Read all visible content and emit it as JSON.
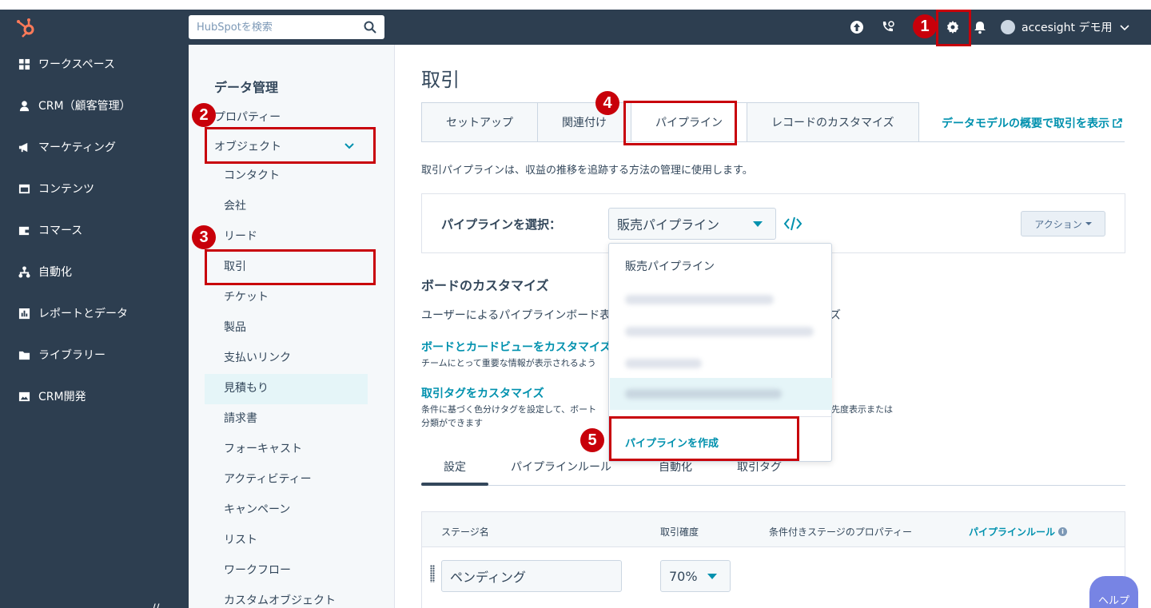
{
  "header": {
    "search_placeholder": "HubSpotを検索",
    "account_name": "accesight デモ用"
  },
  "leftnav": {
    "items": [
      {
        "label": "ワークスペース",
        "icon": "grid-icon"
      },
      {
        "label": "CRM（顧客管理）",
        "icon": "person-icon"
      },
      {
        "label": "マーケティング",
        "icon": "megaphone-icon"
      },
      {
        "label": "コンテンツ",
        "icon": "window-icon"
      },
      {
        "label": "コマース",
        "icon": "wallet-icon"
      },
      {
        "label": "自動化",
        "icon": "flow-icon"
      },
      {
        "label": "レポートとデータ",
        "icon": "report-icon"
      },
      {
        "label": "ライブラリー",
        "icon": "folder-icon"
      },
      {
        "label": "CRM開発",
        "icon": "image-icon"
      }
    ]
  },
  "subnav": {
    "title": "データ管理",
    "property": "プロパティー",
    "objects": "オブジェクト",
    "items": [
      "コンタクト",
      "会社",
      "リード",
      "取引",
      "チケット",
      "製品",
      "支払いリンク",
      "見積もり",
      "請求書",
      "フォーキャスト",
      "アクティビティー",
      "キャンペーン",
      "リスト",
      "ワークフロー",
      "カスタムオブジェクト"
    ]
  },
  "main": {
    "title": "取引",
    "tabs": [
      "セットアップ",
      "関連付け",
      "パイプライン",
      "レコードのカスタマイズ"
    ],
    "model_link": "データモデルの概要で取引を表示",
    "description": "取引パイプラインは、収益の推移を追跡する方法の管理に使用します。",
    "pipeline_label": "パイプラインを選択：",
    "pipeline_selected": "販売パイプライン",
    "action_label": "アクション",
    "board_title": "ボードのカスタマイズ",
    "board_desc": "ユーザーによるパイプラインボード表",
    "board_desc_tail": "ズ",
    "link_board": "ボードとカードビューをカスタマイズ",
    "link_board_desc": "チームにとって重要な情報が表示されるよう",
    "link_tags": "取引タグをカスタマイズ",
    "link_tags_desc": "条件に基づく色分けタグを設定して、ボート",
    "link_tags_desc2": "分類ができます",
    "link_tags_desc_tail": "先度表示または",
    "subtabs": [
      "設定",
      "パイプラインルール",
      "自動化",
      "取引タグ"
    ],
    "table": {
      "headers": [
        "ステージ名",
        "取引確度",
        "条件付きステージのプロパティー",
        "パイプラインルール"
      ],
      "row": {
        "stage": "ペンディング",
        "probability": "70%"
      }
    }
  },
  "dropdown": {
    "first": "販売パイプライン",
    "create": "パイプラインを作成"
  },
  "annotations": [
    "1",
    "2",
    "3",
    "4",
    "5"
  ],
  "help_label": "ヘルプ",
  "colors": {
    "nav_bg": "#2d3e50",
    "link": "#0091ae",
    "annotation": "#c8000a"
  }
}
